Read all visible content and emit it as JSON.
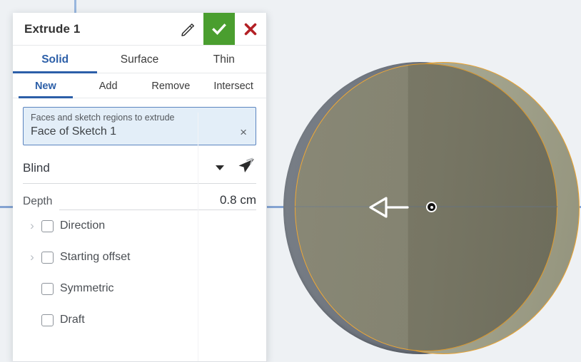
{
  "viewport": {
    "name": "3d-viewport",
    "background_color": "#eef1f4",
    "axis_color": "#7d9ed0",
    "preview_outline_color": "#eda32d",
    "solid_color": "#6e747d",
    "preview_color": "#7b7a68"
  },
  "dialog": {
    "title": "Extrude 1",
    "edit_icon": "pencil-icon",
    "accept_icon": "check-icon",
    "cancel_icon": "x-icon",
    "accept_color": "#4a9e2f",
    "cancel_color": "#b32025",
    "accent_color": "#2c5fa8",
    "tabs": [
      {
        "label": "Solid",
        "active": true
      },
      {
        "label": "Surface",
        "active": false
      },
      {
        "label": "Thin",
        "active": false
      }
    ],
    "operations": [
      {
        "label": "New",
        "active": true
      },
      {
        "label": "Add",
        "active": false
      },
      {
        "label": "Remove",
        "active": false
      },
      {
        "label": "Intersect",
        "active": false
      }
    ],
    "selection": {
      "label": "Faces and sketch regions to extrude",
      "value": "Face of Sketch 1",
      "clear_icon": "×"
    },
    "end_condition": {
      "value": "Blind",
      "caret_icon": "chevron-down-icon",
      "flip_icon": "flip-direction-icon"
    },
    "depth": {
      "label": "Depth",
      "value": "0.8 cm"
    },
    "options": [
      {
        "label": "Direction",
        "checked": false,
        "expandable": true
      },
      {
        "label": "Starting offset",
        "checked": false,
        "expandable": true
      },
      {
        "label": "Symmetric",
        "checked": false,
        "expandable": false
      },
      {
        "label": "Draft",
        "checked": false,
        "expandable": false
      }
    ]
  }
}
